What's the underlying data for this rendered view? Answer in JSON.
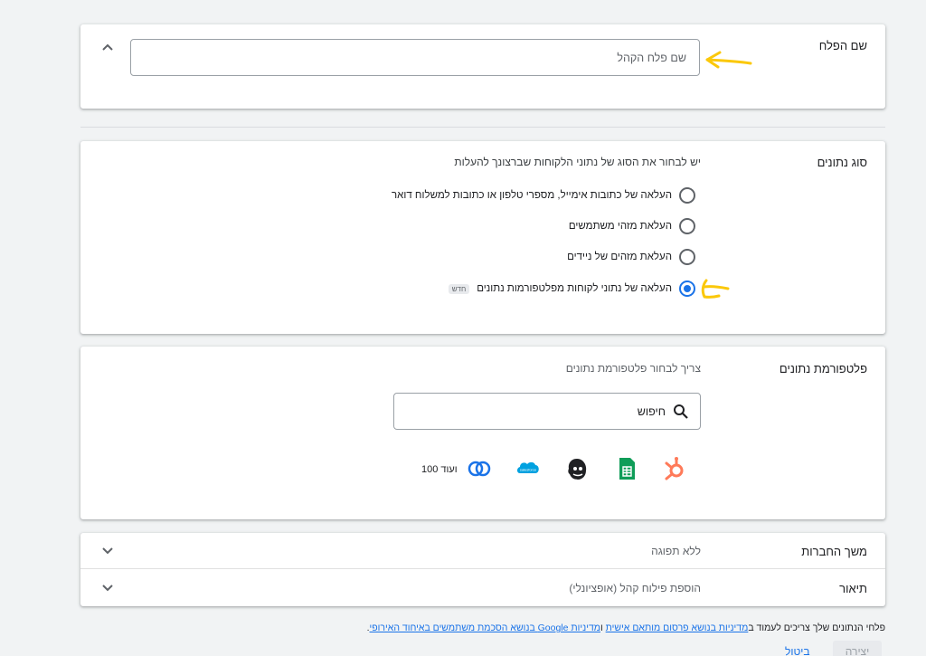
{
  "segment_name": {
    "label": "שם הפלח",
    "placeholder": "שם פלח הקהל"
  },
  "data_type": {
    "label": "סוג נתונים",
    "description": "יש לבחור את הסוג של נתוני הלקוחות שברצונך להעלות",
    "options": [
      {
        "label": "העלאה של כתובות אימייל, מספרי טלפון או כתובות למשלוח דואר",
        "selected": false
      },
      {
        "label": "העלאת מזהי משתמשים",
        "selected": false
      },
      {
        "label": "העלאת מזהים של ניידים",
        "selected": false
      },
      {
        "label": "העלאה של נתוני לקוחות מפלטפורמות נתונים",
        "selected": true,
        "badge": "חדש"
      }
    ]
  },
  "data_platform": {
    "label": "פלטפורמת נתונים",
    "description": "צריך לבחור פלטפורמת נתונים",
    "search_placeholder": "חיפוש",
    "more_label": "ועוד 100",
    "logos": [
      "hubspot-logo-icon",
      "google-sheets-logo-icon",
      "mailchimp-logo-icon",
      "salesforce-logo-icon",
      "zoho-logo-icon"
    ]
  },
  "membership": {
    "label": "משך החברות",
    "value": "ללא תפוגה"
  },
  "description": {
    "label": "תיאור",
    "value": "הוספת פילוח קהל (אופציונלי)"
  },
  "footer": {
    "text_start": "פלחי הנתונים שלך צריכים לעמוד ב",
    "link1": "מדיניות בנושא פרסום מותאם אישית",
    "text_mid": " ו",
    "link2": "מדיניות Google בנושא הסכמת משתמשים באיחוד האירופי",
    "text_end": ".",
    "create_label": "יצירה",
    "cancel_label": "ביטול"
  },
  "colors": {
    "accent": "#1a73e8",
    "annotation": "#fbc80a",
    "hubspot": "#ff7a59",
    "sheets": "#0f9d58",
    "salesforce": "#00a1e0"
  }
}
